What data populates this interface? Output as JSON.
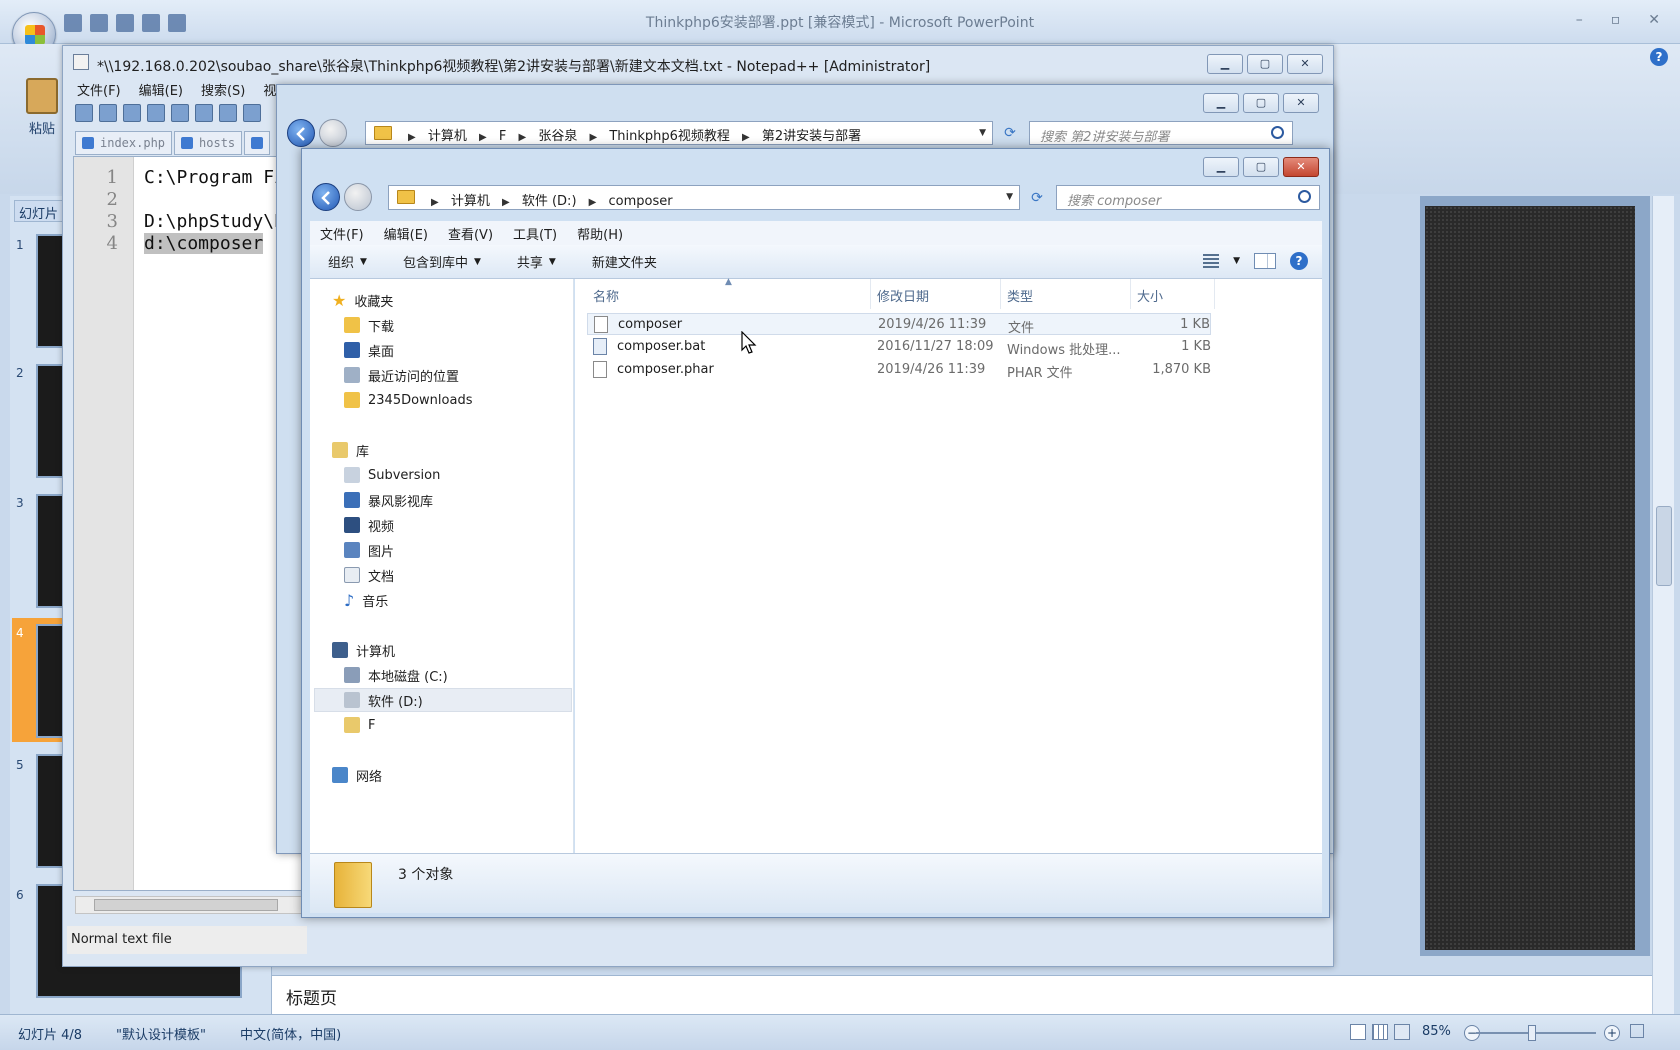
{
  "powerpoint": {
    "title": "Thinkphp6安装部署.ppt [兼容模式] - Microsoft PowerPoint",
    "paste_label": "粘贴",
    "slides_tab": "幻灯片",
    "slide_numbers": [
      "1",
      "2",
      "3",
      "4",
      "5",
      "6"
    ],
    "notes_text": "标题页",
    "status": {
      "slide": "幻灯片 4/8",
      "theme": "\"默认设计模板\"",
      "language": "中文(简体，中国)",
      "zoom": "85%"
    }
  },
  "notepad": {
    "title": "*\\\\192.168.0.202\\soubao_share\\张谷泉\\Thinkphp6视频教程\\第2讲安装与部署\\新建文本文档.txt - Notepad++ [Administrator]",
    "menu": [
      "文件(F)",
      "编辑(E)",
      "搜索(S)",
      "视图(V)"
    ],
    "tabs": [
      "index.php",
      "hosts"
    ],
    "line_numbers": [
      "1",
      "2",
      "3",
      "4"
    ],
    "lines": [
      "C:\\Program Fi",
      "",
      "D:\\phpStudy\\PH",
      "d:\\composer"
    ],
    "status": "Normal text file"
  },
  "explorer_back": {
    "breadcrumb": [
      "计算机",
      "F",
      "张谷泉",
      "Thinkphp6视频教程",
      "第2讲安装与部署"
    ],
    "search_placeholder": "搜索 第2讲安装与部署"
  },
  "explorer": {
    "breadcrumb": [
      "计算机",
      "软件 (D:)",
      "composer"
    ],
    "search_placeholder": "搜索 composer",
    "menu": [
      "文件(F)",
      "编辑(E)",
      "查看(V)",
      "工具(T)",
      "帮助(H)"
    ],
    "commands": [
      "组织",
      "包含到库中",
      "共享",
      "新建文件夹"
    ],
    "nav": {
      "favorites_header": "收藏夹",
      "favorites": [
        "下载",
        "桌面",
        "最近访问的位置",
        "2345Downloads"
      ],
      "libraries_header": "库",
      "libraries": [
        "Subversion",
        "暴风影视库",
        "视频",
        "图片",
        "文档",
        "音乐"
      ],
      "computer_header": "计算机",
      "drives": [
        "本地磁盘 (C:)",
        "软件 (D:)",
        "F"
      ],
      "network_header": "网络"
    },
    "columns": [
      "名称",
      "修改日期",
      "类型",
      "大小"
    ],
    "files": [
      {
        "name": "composer",
        "date": "2019/4/26 11:39",
        "type": "文件",
        "size": "1 KB"
      },
      {
        "name": "composer.bat",
        "date": "2016/11/27 18:09",
        "type": "Windows 批处理...",
        "size": "1 KB"
      },
      {
        "name": "composer.phar",
        "date": "2019/4/26 11:39",
        "type": "PHAR 文件",
        "size": "1,870 KB"
      }
    ],
    "status": "3 个对象"
  }
}
